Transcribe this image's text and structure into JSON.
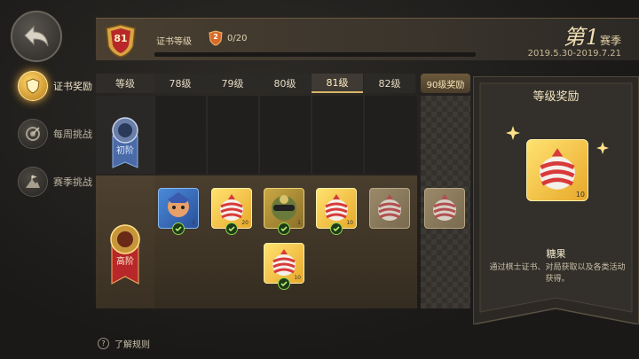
{
  "header": {
    "rank_level": "81",
    "rank_label": "证书等级",
    "exp_icon_value": "2",
    "exp_progress": "0/20",
    "season_prefix": "第",
    "season_number": "1",
    "season_suffix": "赛季",
    "season_dates": "2019.5.30-2019.7.21"
  },
  "sidebar": {
    "items": [
      {
        "label": "证书奖励",
        "active": true
      },
      {
        "label": "每周挑战",
        "active": false
      },
      {
        "label": "赛季挑战",
        "active": false
      }
    ]
  },
  "tabs": {
    "level_header": "等级",
    "levels": [
      "78级",
      "79级",
      "80级",
      "81级",
      "82级"
    ],
    "active_level": "81级",
    "reward_tab": "90级奖励"
  },
  "tiers": {
    "basic": "初阶",
    "advanced": "高阶"
  },
  "rewards": {
    "items": [
      {
        "type": "hero-skin",
        "count": "1",
        "claimed": true
      },
      {
        "type": "candy",
        "count": "20",
        "claimed": true
      },
      {
        "type": "hero-skin",
        "count": "1",
        "claimed": true
      },
      {
        "type": "candy",
        "count": "10",
        "claimed": true
      },
      {
        "type": "candy",
        "count": "",
        "claimed": false
      },
      {
        "type": "candy",
        "count": "",
        "claimed": false
      }
    ],
    "extra": {
      "type": "candy",
      "count": "10",
      "claimed": true
    }
  },
  "panel": {
    "title": "等级奖励",
    "item_count": "10",
    "item_name": "糖果",
    "item_desc": "通过棋士证书、对局获取以及各类活动获得。"
  },
  "help": {
    "label": "了解规则"
  },
  "colors": {
    "accent": "#e8a83a",
    "check": "#8fd44a",
    "badge": "#b8282a"
  }
}
